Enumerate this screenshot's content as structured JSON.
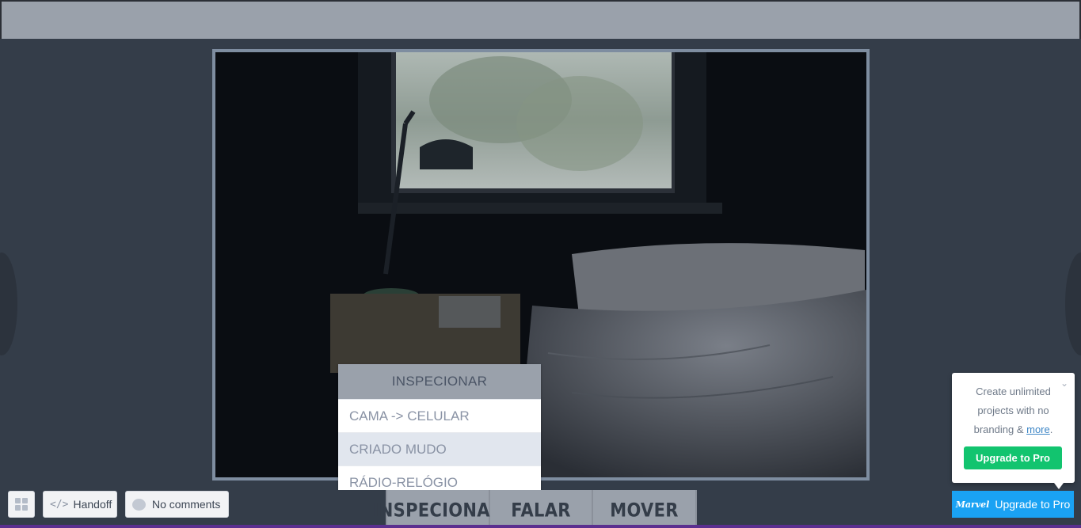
{
  "inspect_menu": {
    "header": "INSPECIONAR",
    "items": [
      {
        "label": "CAMA -> CELULAR"
      },
      {
        "label": "CRIADO MUDO"
      },
      {
        "label": "RÁDIO-RELÓGIO"
      }
    ]
  },
  "toolbar": {
    "grid_icon": "grid-icon",
    "handoff_label": "Handoff",
    "handoff_icon": "code-icon",
    "comments_label": "No comments",
    "comments_icon": "comment-bubble-icon"
  },
  "actions": {
    "inspect_label": "INSPECIONAR",
    "talk_label": "FALAR",
    "move_label": "MOVER"
  },
  "promo": {
    "text_before": "Create unlimited projects with no branding & ",
    "link": "more",
    "text_after": ".",
    "button_label": "Upgrade to Pro"
  },
  "marvel_button": {
    "logo": "Marvel",
    "label": "Upgrade to Pro"
  },
  "colors": {
    "stage": "#343d49",
    "top_bar": "#9aa1ab",
    "promo_button": "#12c46f",
    "marvel_button": "#1aa2f3"
  }
}
